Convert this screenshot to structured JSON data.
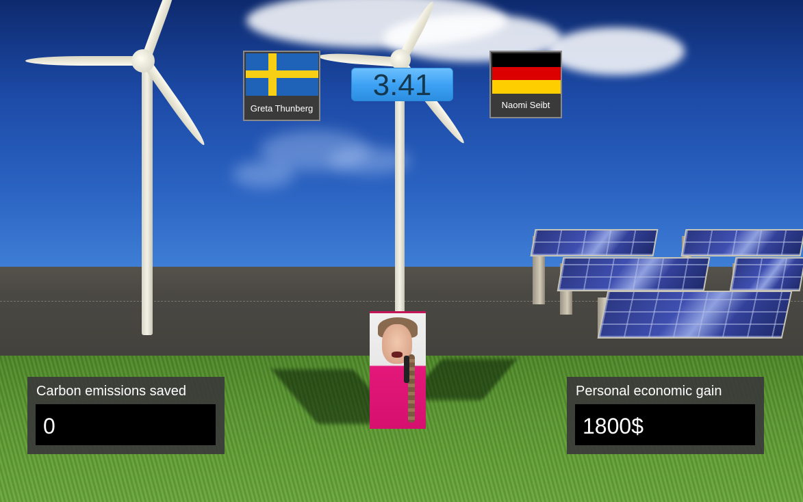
{
  "timer": {
    "text": "3:41"
  },
  "players": {
    "left": {
      "name": "Greta Thunberg",
      "flag": "sweden-flag",
      "colors": {
        "blue": "#1f63b8",
        "yellow": "#f7d016"
      }
    },
    "right": {
      "name": "Naomi Seibt",
      "flag": "germany-flag",
      "colors": {
        "black": "#000000",
        "red": "#dd0000",
        "gold": "#ffce00"
      }
    }
  },
  "stats": {
    "carbon": {
      "label": "Carbon emissions saved",
      "value": "0"
    },
    "economic": {
      "label": "Personal economic gain",
      "value": "1800$"
    }
  },
  "colors": {
    "timer_bg": "#3ea2f4",
    "panel_bg": "#3a3a3a",
    "value_bg": "#000000"
  }
}
